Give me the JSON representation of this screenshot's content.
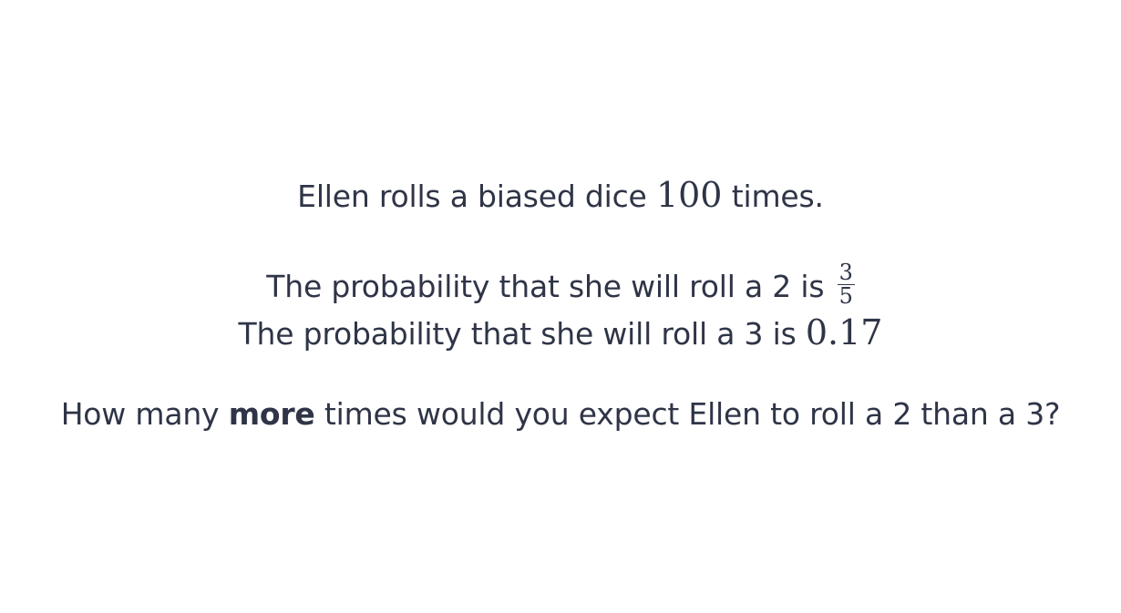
{
  "question": {
    "line1": {
      "before": "Ellen rolls a biased dice ",
      "number": "100",
      "after": " times."
    },
    "line2": {
      "text": "The probability that she will roll a 2 is ",
      "fraction": {
        "numerator": "3",
        "denominator": "5"
      }
    },
    "line3": {
      "text": "The probability that she will roll a 3 is ",
      "value": "0.17"
    },
    "line4": {
      "before": "How many ",
      "emphasis": "more",
      "after": " times would you expect Ellen to roll a 2 than a 3?"
    }
  },
  "colors": {
    "text": "#2f3547",
    "background": "#ffffff"
  }
}
